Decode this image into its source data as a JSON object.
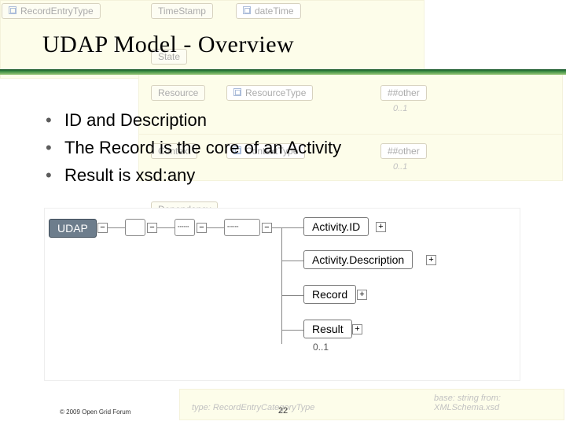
{
  "title": "UDAP Model - Overview",
  "bullets": [
    "ID and Description",
    "The Record is the core of an Activity",
    "Result is xsd:any"
  ],
  "footer": {
    "copyright": "© 2009 Open Grid Forum",
    "page": "22"
  },
  "diagram": {
    "root": "UDAP",
    "children": [
      "Activity.ID",
      "Activity.Description",
      "Record",
      "Result"
    ],
    "result_cardinality": "0..1"
  },
  "background": {
    "items": [
      "RecordEntryType",
      "TimeStamp",
      "dateTime",
      "State",
      "Resource",
      "ResourceType",
      "##other",
      "Context",
      "ContextType",
      "##other",
      "Dependency"
    ],
    "cardinality": "0..1",
    "typehints": [
      "type: RecordEntryCategoryType",
      "base: string from: XMLSchema.xsd"
    ]
  }
}
